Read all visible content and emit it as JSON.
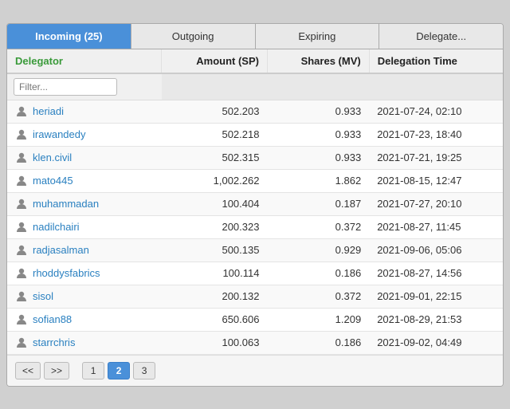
{
  "tabs": [
    {
      "label": "Incoming (25)",
      "active": true
    },
    {
      "label": "Outgoing",
      "active": false
    },
    {
      "label": "Expiring",
      "active": false
    },
    {
      "label": "Delegate...",
      "active": false
    }
  ],
  "table": {
    "columns": [
      {
        "label": "Delegator",
        "key": "delegator"
      },
      {
        "label": "Amount (SP)",
        "key": "amount"
      },
      {
        "label": "Shares (MV)",
        "key": "shares"
      },
      {
        "label": "Delegation Time",
        "key": "time"
      }
    ],
    "filter_placeholder": "Filter...",
    "rows": [
      {
        "delegator": "heriadi",
        "amount": "502.203",
        "shares": "0.933",
        "time": "2021-07-24, 02:10"
      },
      {
        "delegator": "irawandedy",
        "amount": "502.218",
        "shares": "0.933",
        "time": "2021-07-23, 18:40"
      },
      {
        "delegator": "klen.civil",
        "amount": "502.315",
        "shares": "0.933",
        "time": "2021-07-21, 19:25"
      },
      {
        "delegator": "mato445",
        "amount": "1,002.262",
        "shares": "1.862",
        "time": "2021-08-15, 12:47"
      },
      {
        "delegator": "muhammadan",
        "amount": "100.404",
        "shares": "0.187",
        "time": "2021-07-27, 20:10"
      },
      {
        "delegator": "nadilchairi",
        "amount": "200.323",
        "shares": "0.372",
        "time": "2021-08-27, 11:45"
      },
      {
        "delegator": "radjasalman",
        "amount": "500.135",
        "shares": "0.929",
        "time": "2021-09-06, 05:06"
      },
      {
        "delegator": "rhoddysfabrics",
        "amount": "100.114",
        "shares": "0.186",
        "time": "2021-08-27, 14:56"
      },
      {
        "delegator": "sisol",
        "amount": "200.132",
        "shares": "0.372",
        "time": "2021-09-01, 22:15"
      },
      {
        "delegator": "sofian88",
        "amount": "650.606",
        "shares": "1.209",
        "time": "2021-08-29, 21:53"
      },
      {
        "delegator": "starrchris",
        "amount": "100.063",
        "shares": "0.186",
        "time": "2021-09-02, 04:49"
      }
    ]
  },
  "pagination": {
    "prev_label": "<<",
    "next_label": ">>",
    "pages": [
      "1",
      "2",
      "3"
    ],
    "active_page": "2"
  }
}
